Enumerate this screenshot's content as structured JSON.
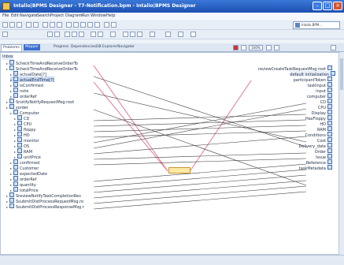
{
  "window": {
    "title": "Intalio|BPMS Designer - T7-Notification.bpm - Intalio|BPMS Designer"
  },
  "menu": [
    "File",
    "Edit",
    "Navigate",
    "Search",
    "Project",
    "Diagram",
    "Run",
    "Window",
    "Help"
  ],
  "search": {
    "label": "Intalio BPM..."
  },
  "tabs": [
    "Problems",
    "Mapper",
    "Progress",
    "Dependencies",
    "DB Explorer",
    "Navigator"
  ],
  "zoom": "100%",
  "left_tree": [
    {
      "label": "Inbox",
      "indent": 0
    },
    {
      "label": "ScheckTimeAndReceiveOrderTo",
      "indent": 1
    },
    {
      "label": "ScheckTimeAndReceiveOrderTo",
      "indent": 1
    },
    {
      "label": "actualDate[?]",
      "indent": 2
    },
    {
      "label": "actualEndTime[?]",
      "indent": 2,
      "sel": true
    },
    {
      "label": "isConfirmed",
      "indent": 2
    },
    {
      "label": "note",
      "indent": 2
    },
    {
      "label": "orderRef",
      "indent": 2
    },
    {
      "label": "SnotifyNotifyRequestMsg.root",
      "indent": 1
    },
    {
      "label": "sorder",
      "indent": 1
    },
    {
      "label": "Computer",
      "indent": 2
    },
    {
      "label": "CD",
      "indent": 3
    },
    {
      "label": "CPU",
      "indent": 3
    },
    {
      "label": "floppy",
      "indent": 3
    },
    {
      "label": "HD",
      "indent": 3
    },
    {
      "label": "monitor",
      "indent": 3
    },
    {
      "label": "OS",
      "indent": 3
    },
    {
      "label": "RAM",
      "indent": 3
    },
    {
      "label": "unitPrice",
      "indent": 3
    },
    {
      "label": "confirmed",
      "indent": 2
    },
    {
      "label": "Customer",
      "indent": 2
    },
    {
      "label": "expectedDate",
      "indent": 2
    },
    {
      "label": "orderRef",
      "indent": 2
    },
    {
      "label": "quantity",
      "indent": 2
    },
    {
      "label": "totalPrice",
      "indent": 2
    },
    {
      "label": "SreviewNotifyTaskCompletionRes",
      "indent": 1
    },
    {
      "label": "SsubmitDistProcessRequestMsg.ro",
      "indent": 1
    },
    {
      "label": "SsubmitDistProcessResponseMsg.r",
      "indent": 1
    }
  ],
  "right_tree": [
    {
      "label": "reviewCreateTaskRequestMsg.root"
    },
    {
      "label": "default initialization"
    },
    {
      "label": "participantToken"
    },
    {
      "label": "taskInput"
    },
    {
      "label": "input"
    },
    {
      "label": "computer"
    },
    {
      "label": "CD"
    },
    {
      "label": "CPU"
    },
    {
      "label": "Display"
    },
    {
      "label": "HasFloppy"
    },
    {
      "label": "HD"
    },
    {
      "label": "RAM"
    },
    {
      "label": "Conditions"
    },
    {
      "label": "Cost"
    },
    {
      "label": "Delivery_date"
    },
    {
      "label": "Order"
    },
    {
      "label": "Issue"
    },
    {
      "label": "Reference"
    },
    {
      "label": "taskMetadata"
    }
  ],
  "colors": {
    "accent": "#3b6fce",
    "mapping_line": "#3a3a3a",
    "highlight_line": "#e36a8a",
    "function_node": "#ffe9a6"
  }
}
